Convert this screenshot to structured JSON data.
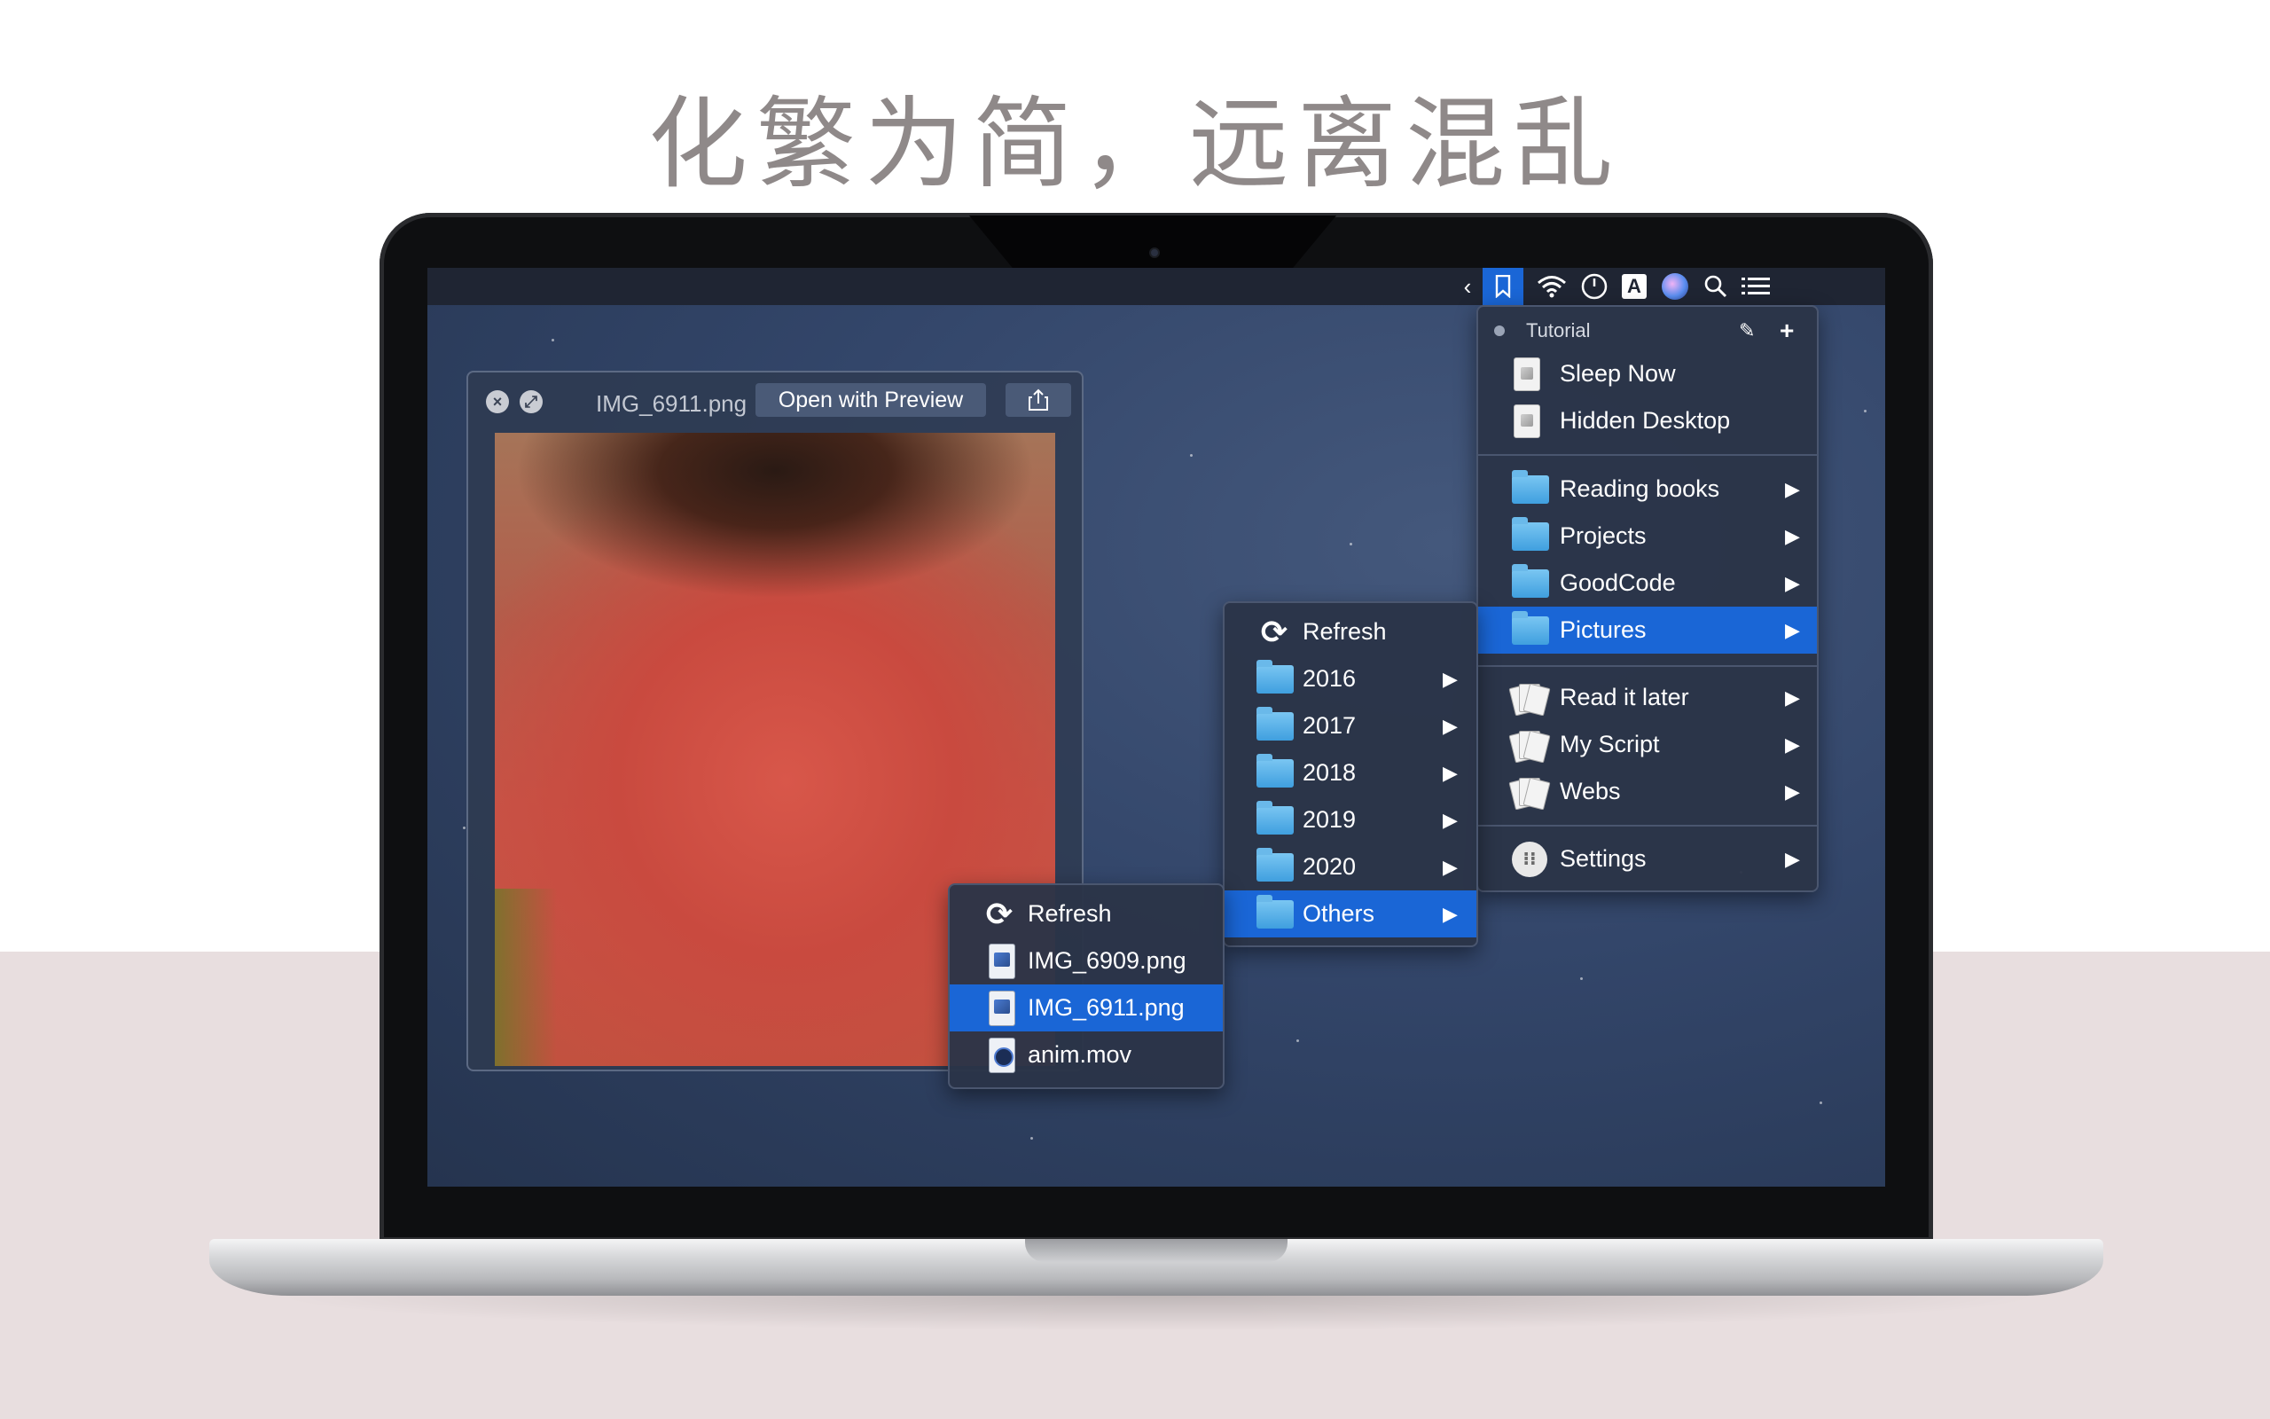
{
  "headline": "化繁为简，远离混乱",
  "menubar": {
    "icons": [
      "chevron-left-icon",
      "bookmark-icon",
      "wifi-icon",
      "clock-icon",
      "input-source-icon",
      "siri-icon",
      "search-icon",
      "list-icon"
    ],
    "input_source_letter": "A"
  },
  "quicklook": {
    "filename": "IMG_6911.png",
    "open_button": "Open with Preview"
  },
  "main_menu": {
    "header": "Tutorial",
    "scripts": [
      {
        "label": "Sleep Now"
      },
      {
        "label": "Hidden Desktop"
      }
    ],
    "folders": [
      {
        "label": "Reading books"
      },
      {
        "label": "Projects"
      },
      {
        "label": "GoodCode"
      },
      {
        "label": "Pictures",
        "selected": true
      }
    ],
    "stacks": [
      {
        "label": "Read it later"
      },
      {
        "label": "My Script"
      },
      {
        "label": "Webs"
      }
    ],
    "settings": "Settings"
  },
  "pictures_menu": {
    "refresh": "Refresh",
    "items": [
      {
        "label": "2016"
      },
      {
        "label": "2017"
      },
      {
        "label": "2018"
      },
      {
        "label": "2019"
      },
      {
        "label": "2020"
      },
      {
        "label": "Others",
        "selected": true
      }
    ]
  },
  "others_menu": {
    "refresh": "Refresh",
    "files": [
      {
        "label": "IMG_6909.png",
        "type": "png"
      },
      {
        "label": "IMG_6911.png",
        "type": "png",
        "selected": true
      },
      {
        "label": "anim.mov",
        "type": "mov"
      }
    ]
  },
  "colors": {
    "selection": "#1a66d6",
    "menu_bg": "#2b3448",
    "desktop": "#33466a"
  }
}
